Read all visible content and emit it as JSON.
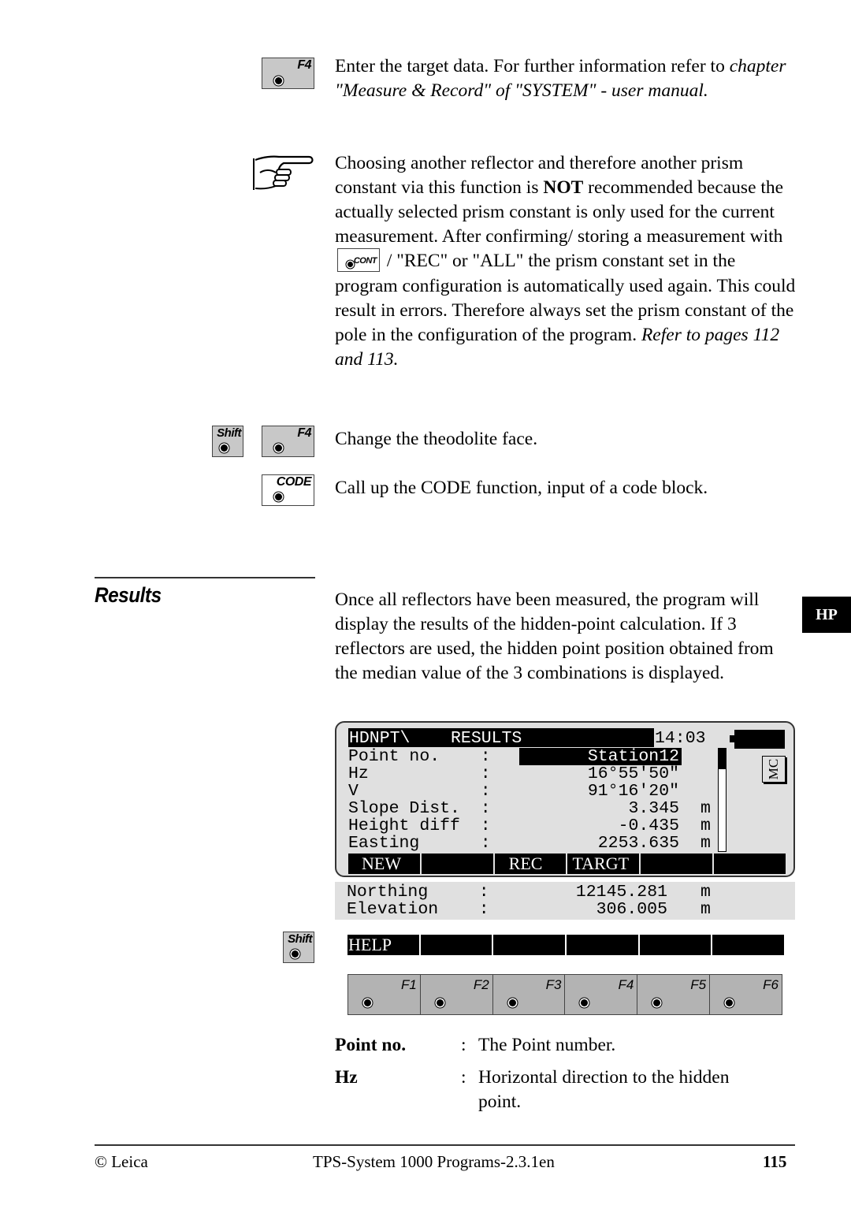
{
  "keys": {
    "f4": "F4",
    "shift": "Shift",
    "code": "CODE",
    "cont": "CONT"
  },
  "paragraphs": {
    "p1_plain": "Enter the target data. For further information refer to",
    "p1_italic": "chapter \"Measure & Record\" of \"SYSTEM\" - user manual.",
    "note_a": "Choosing another reflector and therefore another prism constant via this function is ",
    "note_bold": "NOT",
    "note_b": " recommended because the actually selected prism constant is only used for the current measurement. After confirming/ storing a measurement with",
    "note_c": " / \"REC\" or \"ALL\" the prism constant set in the program configuration is automatically used again. This could result in errors. Therefore always set the prism constant of the pole in the configuration of the program. ",
    "note_italic": "Refer to pages 112 and 113.",
    "shift_f4": "Change the theodolite face.",
    "code_text": "Call up the CODE function, input of a code block.",
    "results_intro": "Once all reflectors have been measured, the program will display the results of the hidden-point calculation. If 3 reflectors are used, the hidden point position obtained from the median value of the 3 combinations is displayed."
  },
  "section": {
    "title": "Results",
    "tab": "HP"
  },
  "screen": {
    "title": "HDNPT\\    RESULTS",
    "time": "14:03",
    "mc_label": "MC",
    "rows": [
      {
        "label": "Point no.    :",
        "value": "Station12",
        "unit": ""
      },
      {
        "label": "Hz           :",
        "value": "16°55'50\"",
        "unit": ""
      },
      {
        "label": "V            :",
        "value": "91°16'20\"",
        "unit": ""
      },
      {
        "label": "Slope Dist.  :",
        "value": "3.345",
        "unit": "m"
      },
      {
        "label": "Height diff  :",
        "value": "-0.435",
        "unit": "m"
      },
      {
        "label": "Easting      :",
        "value": "2253.635",
        "unit": "m"
      }
    ],
    "softkeys": [
      "NEW",
      "",
      "REC",
      "TARGT",
      "",
      ""
    ],
    "extra_rows": [
      {
        "label": "Northing     :",
        "value": "12145.281",
        "unit": "m"
      },
      {
        "label": "Elevation    :",
        "value": "306.005",
        "unit": "m"
      }
    ],
    "shift_softkeys": [
      "HELP",
      "",
      "",
      "",
      "",
      ""
    ],
    "function_keys": [
      "F1",
      "F2",
      "F3",
      "F4",
      "F5",
      "F6"
    ]
  },
  "definitions": [
    {
      "term": "Point no.",
      "text": "The Point number."
    },
    {
      "term": "Hz",
      "text": "Horizontal direction to the hidden point."
    }
  ],
  "footer": {
    "left": "© Leica",
    "center": "TPS-System 1000 Programs-2.3.1en",
    "page": "115"
  }
}
